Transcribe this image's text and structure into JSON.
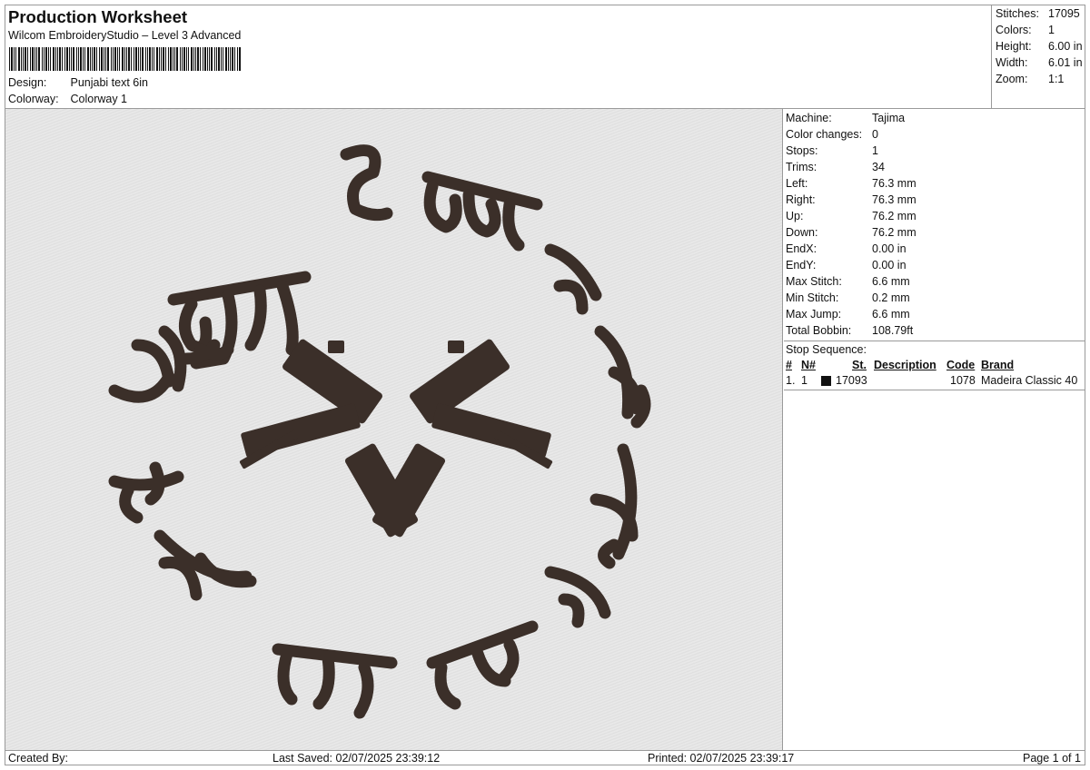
{
  "header": {
    "title": "Production Worksheet",
    "subtitle": "Wilcom EmbroideryStudio – Level 3 Advanced",
    "design_label": "Design:",
    "design_value": "Punjabi text 6in",
    "colorway_label": "Colorway:",
    "colorway_value": "Colorway 1"
  },
  "stats": [
    {
      "label": "Stitches:",
      "value": "17095"
    },
    {
      "label": "Colors:",
      "value": "1"
    },
    {
      "label": "Height:",
      "value": "6.00 in"
    },
    {
      "label": "Width:",
      "value": "6.01 in"
    },
    {
      "label": "Zoom:",
      "value": "1:1"
    }
  ],
  "properties": [
    {
      "label": "Machine:",
      "value": "Tajima"
    },
    {
      "label": "Color changes:",
      "value": "0"
    },
    {
      "label": "Stops:",
      "value": "1"
    },
    {
      "label": "Trims:",
      "value": "34"
    },
    {
      "label": "Left:",
      "value": "76.3 mm"
    },
    {
      "label": "Right:",
      "value": "76.3 mm"
    },
    {
      "label": "Up:",
      "value": "76.2 mm"
    },
    {
      "label": "Down:",
      "value": "76.2 mm"
    },
    {
      "label": "EndX:",
      "value": "0.00 in"
    },
    {
      "label": "EndY:",
      "value": "0.00 in"
    },
    {
      "label": "Max Stitch:",
      "value": "6.6 mm"
    },
    {
      "label": "Min Stitch:",
      "value": "0.2 mm"
    },
    {
      "label": "Max Jump:",
      "value": "6.6 mm"
    },
    {
      "label": "Total Bobbin:",
      "value": "108.79ft"
    }
  ],
  "stop_sequence": {
    "title": "Stop Sequence:",
    "columns": {
      "num": "#",
      "n": "N#",
      "st": "St.",
      "description": "Description",
      "code": "Code",
      "brand": "Brand"
    },
    "rows": [
      {
        "num": "1.",
        "n": "1",
        "color": "#111111",
        "st": "17093",
        "description": "",
        "code": "1078",
        "brand": "Madeira Classic 40"
      }
    ]
  },
  "footer": {
    "created_by": "Created By:",
    "last_saved": "Last Saved: 02/07/2025 23:39:12",
    "printed": "Printed: 02/07/2025 23:39:17",
    "page": "Page 1 of 1"
  },
  "design_thread_color": "#3b2f29"
}
